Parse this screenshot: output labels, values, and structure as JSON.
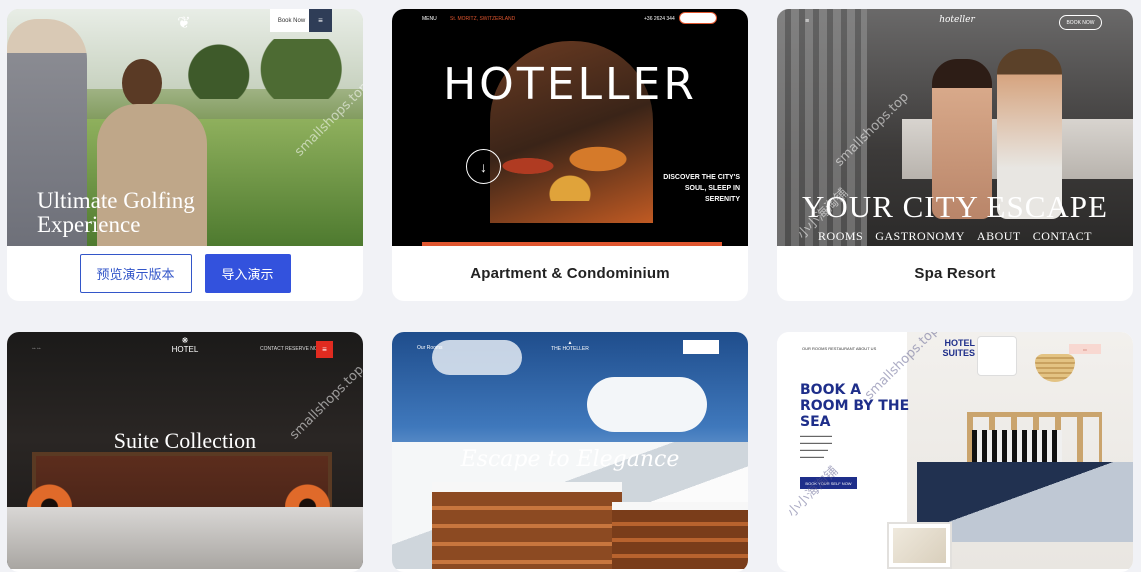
{
  "cards": [
    {
      "id": "golf",
      "title": "Ultimate Golfing Experience",
      "top_book": "Book Now",
      "menu_icon": "hamburger-icon",
      "actions": {
        "preview": "预览演示版本",
        "import": "导入演示"
      }
    },
    {
      "id": "hoteller",
      "caption": "Apartment & Condominium",
      "logo_word": "HOTELLER",
      "menu": "MENU",
      "address": "St. MORITZ, SWITZERLAND",
      "phone": "+36 2624 344",
      "book": "BOOK NOW",
      "tagline": "DISCOVER THE CITY'S SOUL, SLEEP IN SERENITY",
      "arrow_icon": "arrow-down-icon"
    },
    {
      "id": "spa",
      "caption": "Spa Resort",
      "logo": "hoteller",
      "book": "BOOK NOW",
      "title": "YOUR CITY ESCAPE",
      "nav": [
        "ROOMS",
        "GASTRONOMY",
        "ABOUT",
        "CONTACT"
      ]
    },
    {
      "id": "suite",
      "logo": "HOTEL",
      "title": "Suite Collection",
      "nav_right": "CONTACT   RESERVE NOW"
    },
    {
      "id": "escape",
      "logo": "THE HOTELLER",
      "title": "Escape to Elegance",
      "nav": "Our Rooms",
      "book": "Book Now"
    },
    {
      "id": "book",
      "brand": "HOTEL SUITES",
      "nav": "OUR ROOMS   RESTAURANT   ABOUT US",
      "title": "BOOK A ROOM BY THE SEA",
      "cta": "BOOK YOUR SELF NOW"
    }
  ],
  "watermark": "smallshops.top",
  "watermark_cn": "小小海淘铺"
}
